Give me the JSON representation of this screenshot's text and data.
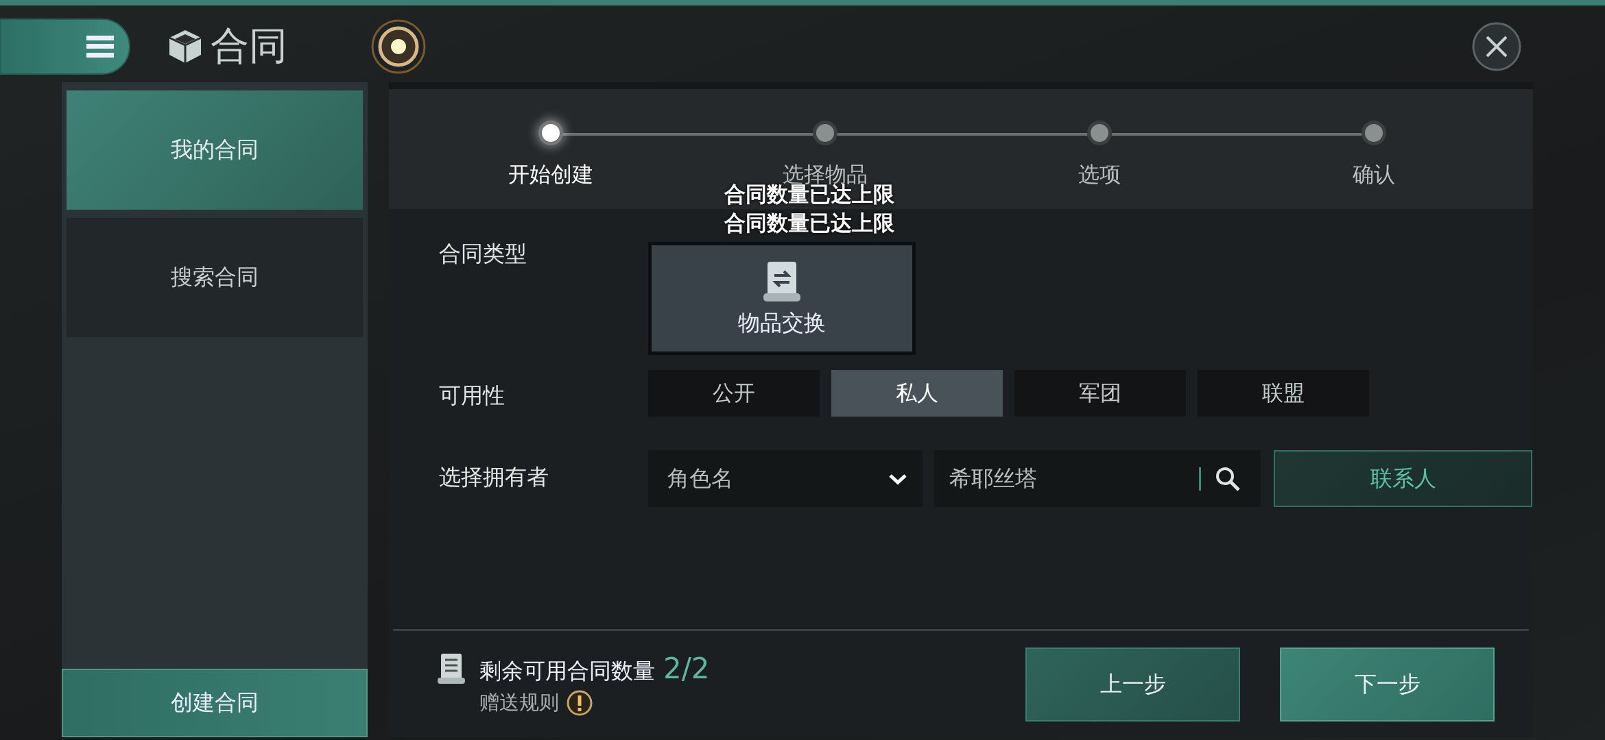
{
  "header": {
    "title": "合同"
  },
  "sidebar": {
    "items": [
      {
        "label": "我的合同",
        "selected": true
      },
      {
        "label": "搜索合同",
        "selected": false
      }
    ],
    "create_button": "创建合同"
  },
  "stepper": {
    "steps": [
      {
        "label": "开始创建",
        "selected": true
      },
      {
        "label": "选择物品",
        "selected": false
      },
      {
        "label": "选项",
        "selected": false
      },
      {
        "label": "确认",
        "selected": false
      }
    ]
  },
  "toasts": [
    "合同数量已达上限",
    "合同数量已达上限"
  ],
  "form": {
    "contract_type": {
      "label": "合同类型",
      "options": [
        {
          "label": "物品交换",
          "selected": true
        }
      ]
    },
    "availability": {
      "label": "可用性",
      "options": [
        {
          "label": "公开",
          "selected": false
        },
        {
          "label": "私人",
          "selected": true
        },
        {
          "label": "军团",
          "selected": false
        },
        {
          "label": "联盟",
          "selected": false
        }
      ]
    },
    "owner": {
      "label": "选择拥有者",
      "dropdown": {
        "value": "角色名"
      },
      "search": {
        "value": "希耶丝塔"
      },
      "contacts_button": "联系人"
    }
  },
  "footer": {
    "remaining_label": "剩余可用合同数量",
    "remaining_count": "2/2",
    "rules_link": "赠送规则",
    "prev_button": "上一步",
    "next_button": "下一步"
  }
}
